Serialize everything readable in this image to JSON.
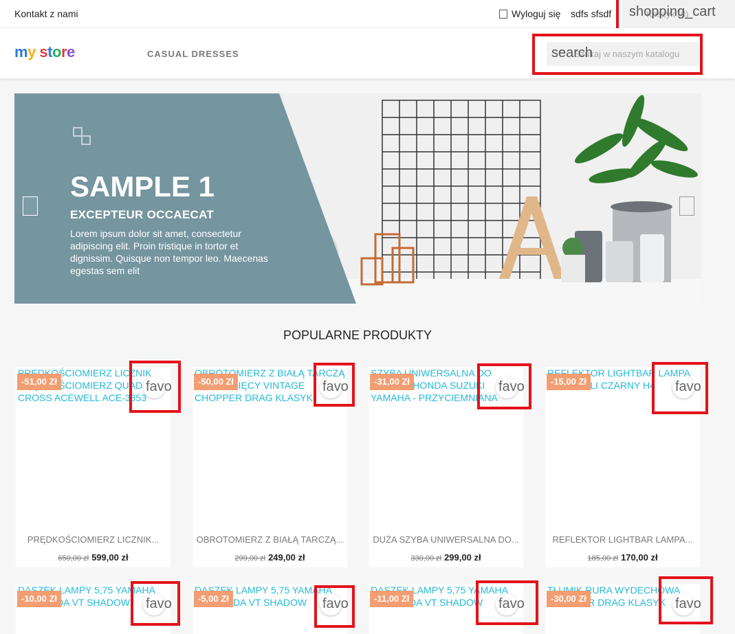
{
  "topbar": {
    "contact": "Kontakt z nami",
    "logout": "Wyloguj się",
    "user": "sdfs sfsdf",
    "cart_label": "shopping_cart",
    "cart_under": "Koszyk (0)"
  },
  "header": {
    "logo_letters": [
      "m",
      "y",
      " s",
      "t",
      "o",
      "r",
      "e"
    ],
    "nav_item": "CASUAL DRESSES",
    "search_icon": "search",
    "search_placeholder": "Szukaj w naszym katalogu"
  },
  "banner": {
    "title": "SAMPLE 1",
    "subtitle": "EXCEPTEUR OCCAECAT",
    "text": "Lorem ipsum dolor sit amet, consectetur adipiscing elit. Proin tristique in tortor et dignissim. Quisque non tempor leo. Maecenas egestas sem elit"
  },
  "section_title": "POPULARNE PRODUKTY",
  "fav_label": "favo",
  "products": [
    {
      "alt": "PRĘDKOŚCIOMIERZ LICZNIK PRĘDKOŚCIOMIERZ QUAD ATV CROSS ACEWELL ACE-3853",
      "badge": "-51,00 Zł",
      "name": "PRĘDKOŚCIOMIERZ LICZNIK...",
      "old": "650,00 zł",
      "new": "599,00 zł"
    },
    {
      "alt": "OBROTOMIERZ Z BIAŁĄ TARCZĄ DO 8 TYSIĘCY VINTAGE CHOPPER DRAG KLASYK",
      "badge": "-50,00 Zł",
      "name": "OBROTOMIERZ Z BIAŁĄ TARCZĄ...",
      "old": "299,00 zł",
      "new": "249,00 zł"
    },
    {
      "alt": "SZYBA UNIWERSALNA DO YAMAHA HONDA SUZUKI YAMAHA - PRZYCIEMNIANA",
      "badge": "-31,00 Zł",
      "name": "DUŻA SZYBA UNIWERSALNA DO...",
      "old": "330,00 zł",
      "new": "299,00 zł"
    },
    {
      "alt": "REFLEKTOR LIGHTBAR LAMPA LED 7 CALI CZARNY H4",
      "badge": "-15,00 Zł",
      "name": "REFLEKTOR LIGHTBAR LAMPA...",
      "old": "185,00 zł",
      "new": "170,00 zł"
    },
    {
      "alt": "DASZEK LAMPY 5,75 YAMAHA DO HONDA VT SHADOW",
      "badge": "-10,00 Zł"
    },
    {
      "alt": "DASZEK LAMPY 5,75 YAMAHA DO HONDA VT SHADOW",
      "badge": "-5,00 Zł"
    },
    {
      "alt": "DASZEK LAMPY 5,75 YAMAHA DO HONDA VT SHADOW",
      "badge": "-11,00 Zł"
    },
    {
      "alt": "TŁUMIK RURA WYDECHOWA CHOPPER DRAG KLASYK",
      "badge": "-30,00 Zł"
    }
  ],
  "colors": {
    "accent_link": "#24b9d7",
    "badge_bg": "#f39d72",
    "banner_panel": "#75959f",
    "highlight_box": "#e3121b"
  }
}
